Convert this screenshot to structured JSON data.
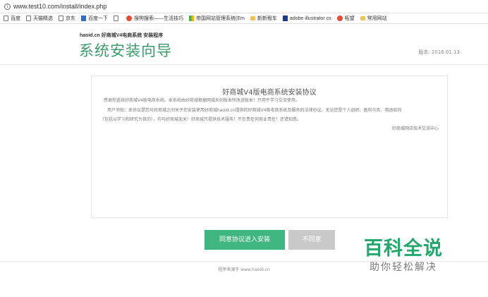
{
  "browser": {
    "url": "www.test10.com/install/index.php",
    "bookmarks": [
      {
        "label": "百度",
        "icon": "page-icon"
      },
      {
        "label": "天猫精选",
        "icon": "page-icon"
      },
      {
        "label": "京东",
        "icon": "page-icon"
      },
      {
        "label": "百度一下",
        "icon": "baidu-icon"
      },
      {
        "label": "",
        "icon": "page-icon"
      },
      {
        "label": "搜狗搜索——生活技巧",
        "icon": "sogou-icon"
      },
      {
        "label": "帝国网站管理系统(Em",
        "icon": "empire-icon"
      },
      {
        "label": "新新租车",
        "icon": "folder-icon"
      },
      {
        "label": "adobe illustrator cs",
        "icon": "adobe-icon"
      },
      {
        "label": "柘望",
        "icon": "sogou-icon"
      },
      {
        "label": "常用网站",
        "icon": "folder-icon"
      }
    ]
  },
  "header": {
    "site_name": "haoid.cn 好商城V4电商系统 安装程序",
    "title": "系统安装向导",
    "version": "版本: 2016.01.13"
  },
  "agreement": {
    "title": "好商城V4版电商系统安装协议",
    "paragraphs": [
      "感谢你选择好商城V4版电商系统。本系统由好商城根据网城天创版本所改进版本！只用于学习交流使用。",
      "用户须知：本协议是您与好商城之间关于您安装使用好商城haoid.cn提供的好商城V4版电商系统及服务的法律协议。无论您是个人组织、盈利与否、用途如何",
      "（包括以学习和研究为目的），均与好商城无关！好商城只提供技术服务！不负责任何商业责任！还请知悉。"
    ],
    "signature": "好商城网店技术交流中心"
  },
  "buttons": {
    "agree": "同意协议进入安装",
    "disagree": "不同意"
  },
  "footer": {
    "text": "程序来源于 www.haoid.cn"
  },
  "watermark": {
    "main": "百科全说",
    "sub": "助你轻松解决"
  }
}
